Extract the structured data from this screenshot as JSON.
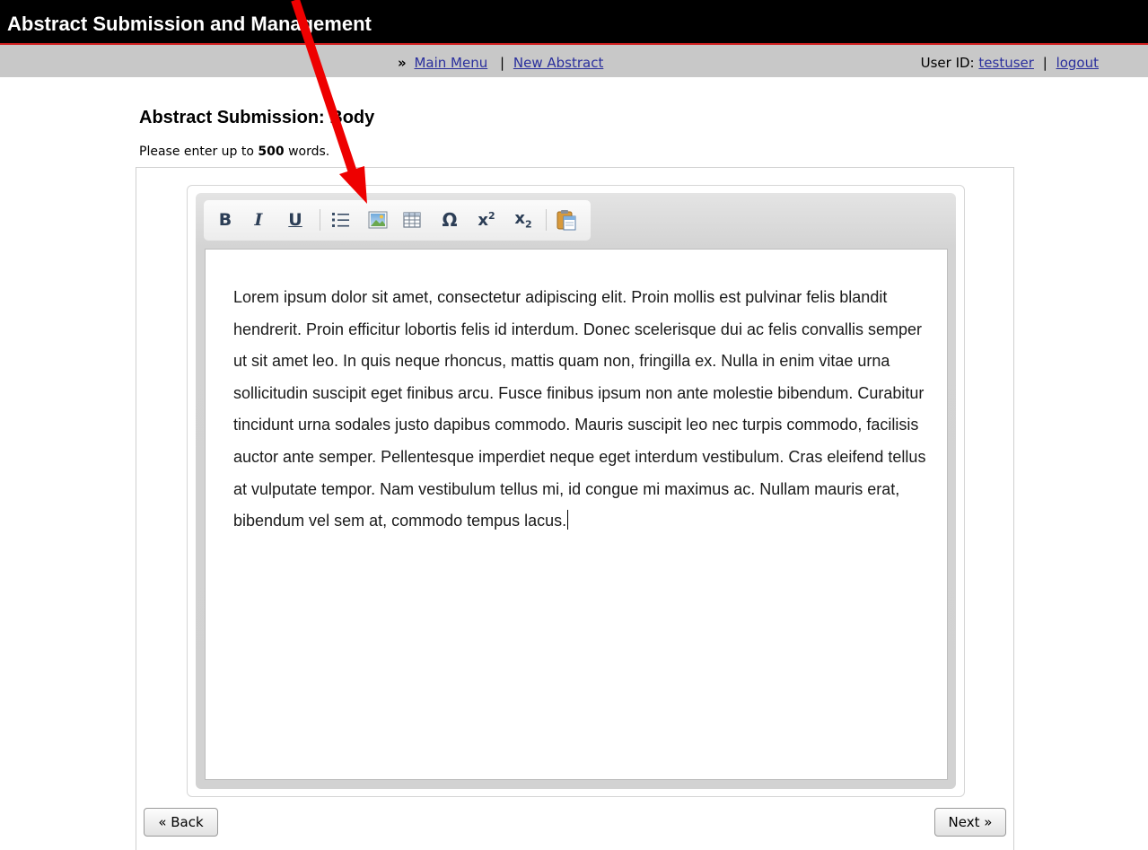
{
  "header": {
    "title": "Abstract Submission and Management"
  },
  "nav": {
    "raquo": "»",
    "main_menu": "Main Menu",
    "separator": "|",
    "new_abstract": "New Abstract",
    "user_label": "User ID:",
    "username": "testuser",
    "logout": "logout"
  },
  "page": {
    "title": "Abstract Submission: Body",
    "instruction_prefix": "Please enter up to ",
    "word_limit": "500",
    "instruction_suffix": " words."
  },
  "toolbar": {
    "bold": "B",
    "italic": "I",
    "underline": "U",
    "buttons": [
      {
        "name": "bold-button",
        "icon": "bold-icon"
      },
      {
        "name": "italic-button",
        "icon": "italic-icon"
      },
      {
        "name": "underline-button",
        "icon": "underline-icon"
      },
      {
        "name": "bullet-list-button",
        "icon": "bullet-list-icon"
      },
      {
        "name": "insert-image-button",
        "icon": "image-icon"
      },
      {
        "name": "insert-table-button",
        "icon": "table-icon"
      },
      {
        "name": "special-character-button",
        "icon": "omega-icon"
      },
      {
        "name": "superscript-button",
        "icon": "superscript-icon"
      },
      {
        "name": "subscript-button",
        "icon": "subscript-icon"
      },
      {
        "name": "paste-button",
        "icon": "paste-icon"
      }
    ]
  },
  "editor": {
    "body_text": "Lorem ipsum dolor sit amet, consectetur adipiscing elit. Proin mollis est pulvinar felis blandit hendrerit. Proin efficitur lobortis felis id interdum. Donec scelerisque dui ac felis convallis semper ut sit amet leo. In quis neque rhoncus, mattis quam non, fringilla ex. Nulla in enim vitae urna sollicitudin suscipit eget finibus arcu. Fusce finibus ipsum non ante molestie bibendum. Curabitur tincidunt urna sodales justo dapibus commodo. Mauris suscipit leo nec turpis commodo, facilisis auctor ante semper. Pellentesque imperdiet neque eget interdum vestibulum. Cras eleifend tellus at vulputate tempor. Nam vestibulum tellus mi, id congue mi maximus ac. Nullam mauris erat, bibendum vel sem at, commodo tempus lacus."
  },
  "buttons": {
    "back": "« Back",
    "next": "Next »"
  },
  "colors": {
    "header_bg": "#000000",
    "header_border": "#d11f1f",
    "navbar_bg": "#c8c8c8",
    "link": "#2a2f9d",
    "annotation_arrow": "#ee0000"
  }
}
